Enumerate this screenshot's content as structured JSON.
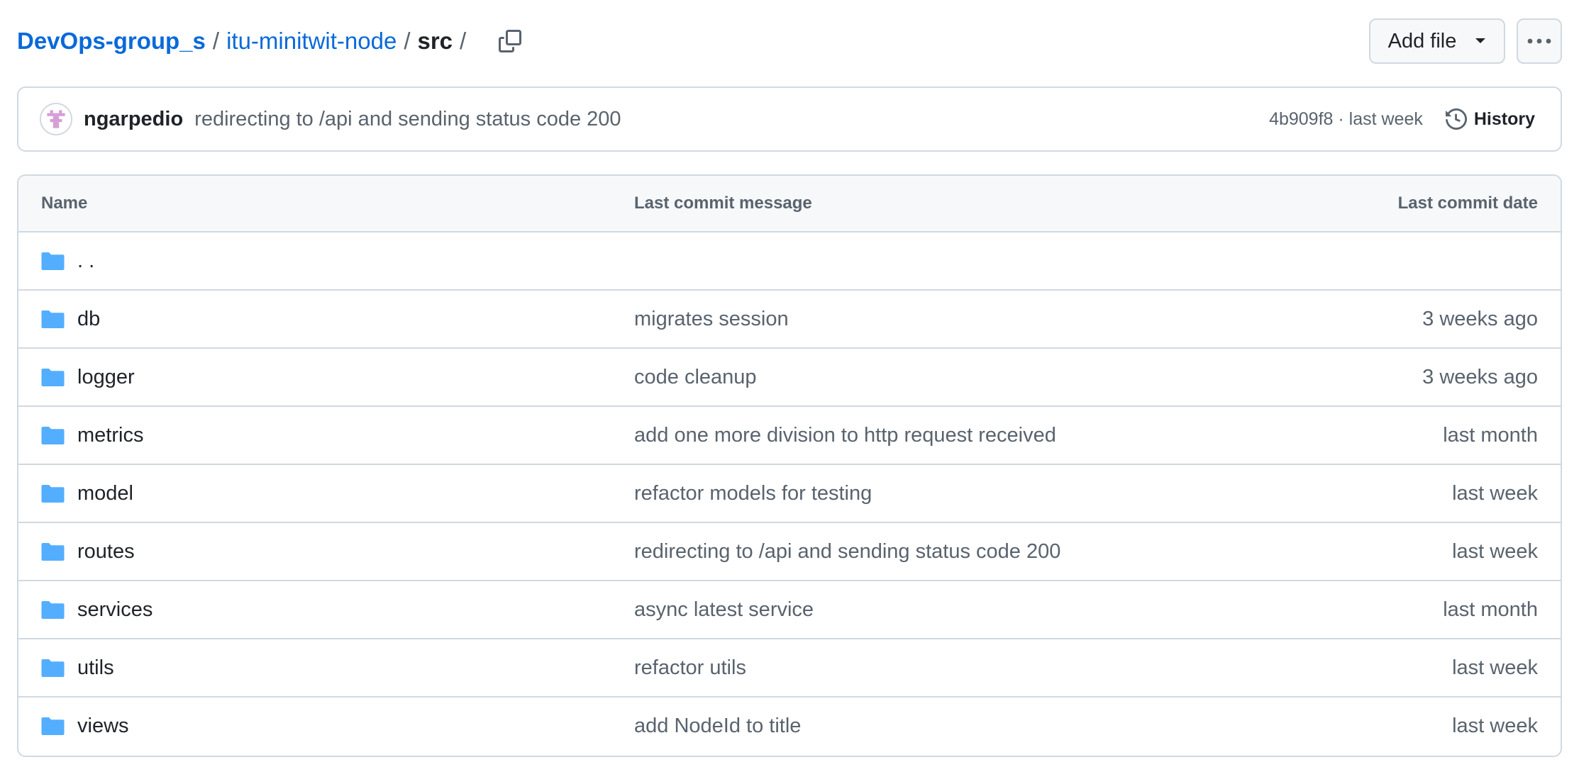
{
  "breadcrumb": {
    "owner": "DevOps-group_s",
    "repo": "itu-minitwit-node",
    "current": "src",
    "separator": "/"
  },
  "actions": {
    "add_file_label": "Add file",
    "more_icon": "kebab-horizontal-icon"
  },
  "latest_commit": {
    "author": "ngarpedio",
    "message": "redirecting to /api and sending status code 200",
    "sha_time": "4b909f8 · last week",
    "history_label": "History"
  },
  "table": {
    "headers": {
      "name": "Name",
      "message": "Last commit message",
      "date": "Last commit date"
    },
    "parent": {
      "name": ". ."
    },
    "rows": [
      {
        "name": "db",
        "message": "migrates session",
        "date": "3 weeks ago"
      },
      {
        "name": "logger",
        "message": "code cleanup",
        "date": "3 weeks ago"
      },
      {
        "name": "metrics",
        "message": "add one more division to http request received",
        "date": "last month"
      },
      {
        "name": "model",
        "message": "refactor models for testing",
        "date": "last week"
      },
      {
        "name": "routes",
        "message": "redirecting to /api and sending status code 200",
        "date": "last week"
      },
      {
        "name": "services",
        "message": "async latest service",
        "date": "last month"
      },
      {
        "name": "utils",
        "message": "refactor utils",
        "date": "last week"
      },
      {
        "name": "views",
        "message": "add NodeId to title",
        "date": "last week"
      }
    ]
  },
  "colors": {
    "link": "#0969da",
    "folder": "#54aeff",
    "border": "#d1d9e0",
    "muted": "#59636e",
    "header_bg": "#f6f8fa"
  }
}
